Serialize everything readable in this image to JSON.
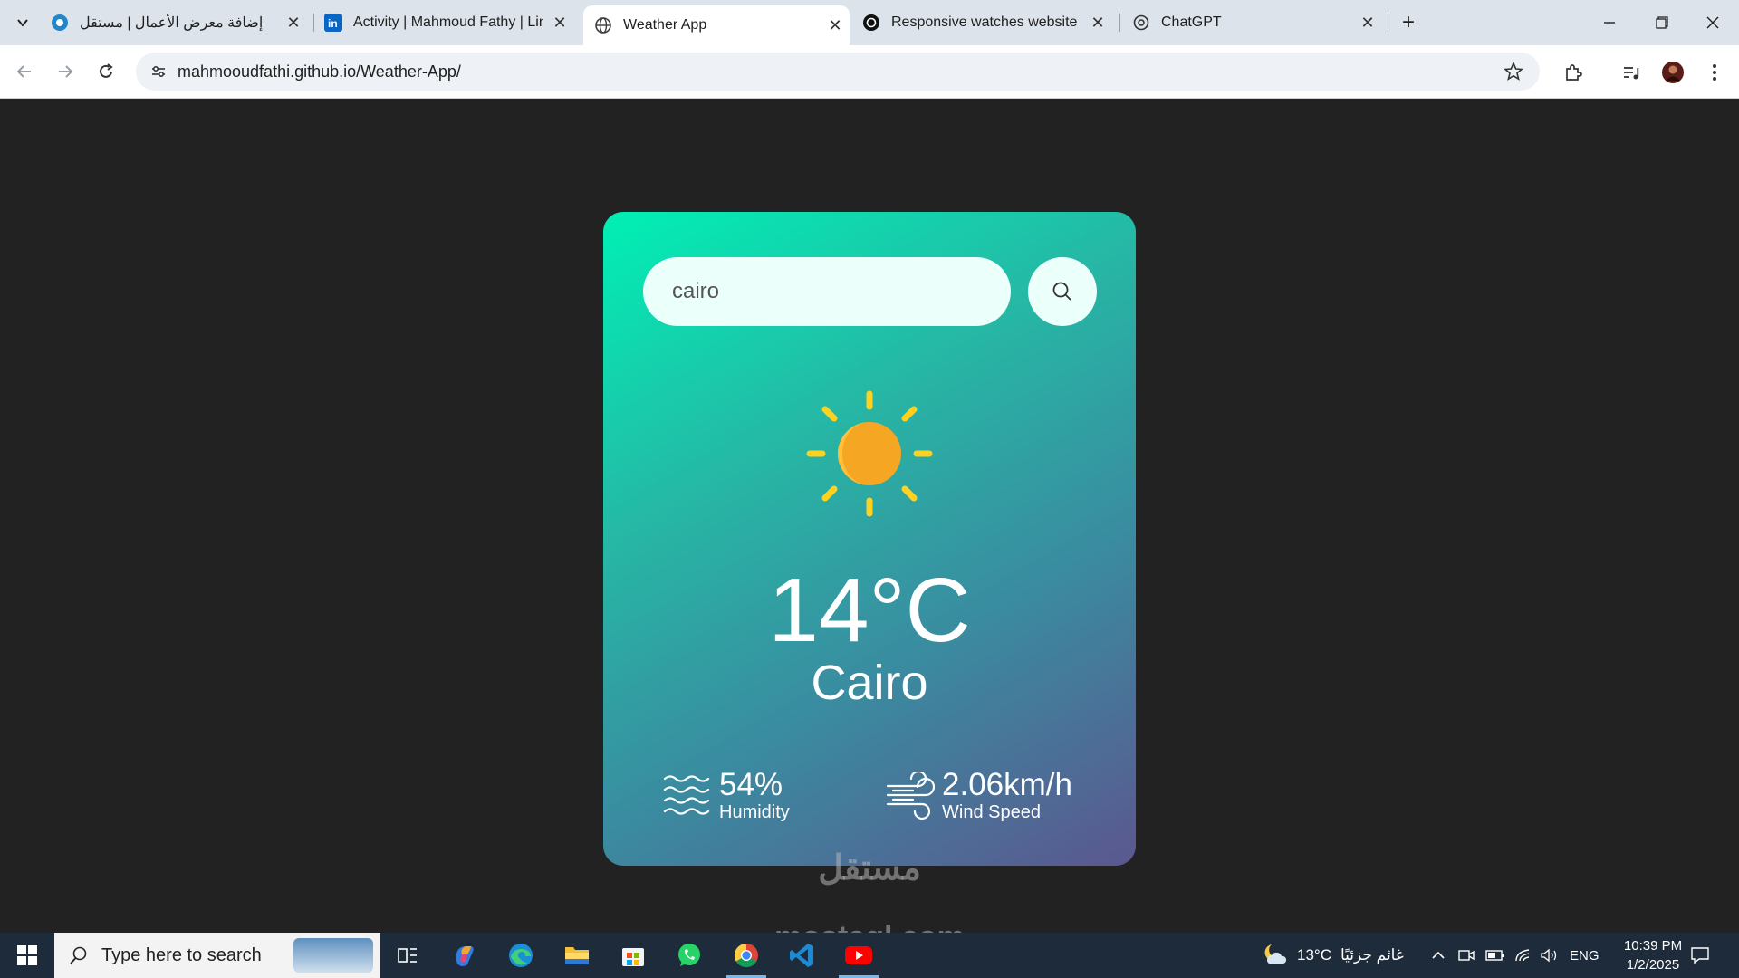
{
  "browser": {
    "tabs": [
      {
        "title": "إضافة معرض الأعمال | مستقل",
        "icon": "mostaql-icon",
        "active": false
      },
      {
        "title": "Activity | Mahmoud Fathy | LinkedIn",
        "icon": "linkedin-icon",
        "active": false
      },
      {
        "title": "Weather App",
        "icon": "globe-icon",
        "active": true
      },
      {
        "title": "Responsive watches website",
        "icon": "site-icon",
        "active": false
      },
      {
        "title": "ChatGPT",
        "icon": "chatgpt-icon",
        "active": false
      }
    ],
    "url": "mahmooudfathi.github.io/Weather-App/"
  },
  "weather": {
    "search_value": "cairo",
    "icon": "sun-icon",
    "temperature": "14°C",
    "city": "Cairo",
    "humidity_value": "54%",
    "humidity_label": "Humidity",
    "wind_value": "2.06km/h",
    "wind_label": "Wind Speed"
  },
  "watermark": {
    "arabic": "مستقل",
    "latin": "mostaql.com"
  },
  "taskbar": {
    "search_placeholder": "Type here to search",
    "weather_temp": "13°C",
    "weather_desc": "غائم جزئيًا",
    "language": "ENG",
    "time": "10:39 PM",
    "date": "1/2/2025"
  },
  "colors": {
    "card_gradient_start": "#00f0b5",
    "card_gradient_end": "#5b578f",
    "sun": "#f5a623",
    "sun_rays": "#ffd21f",
    "page_background": "#222222"
  }
}
